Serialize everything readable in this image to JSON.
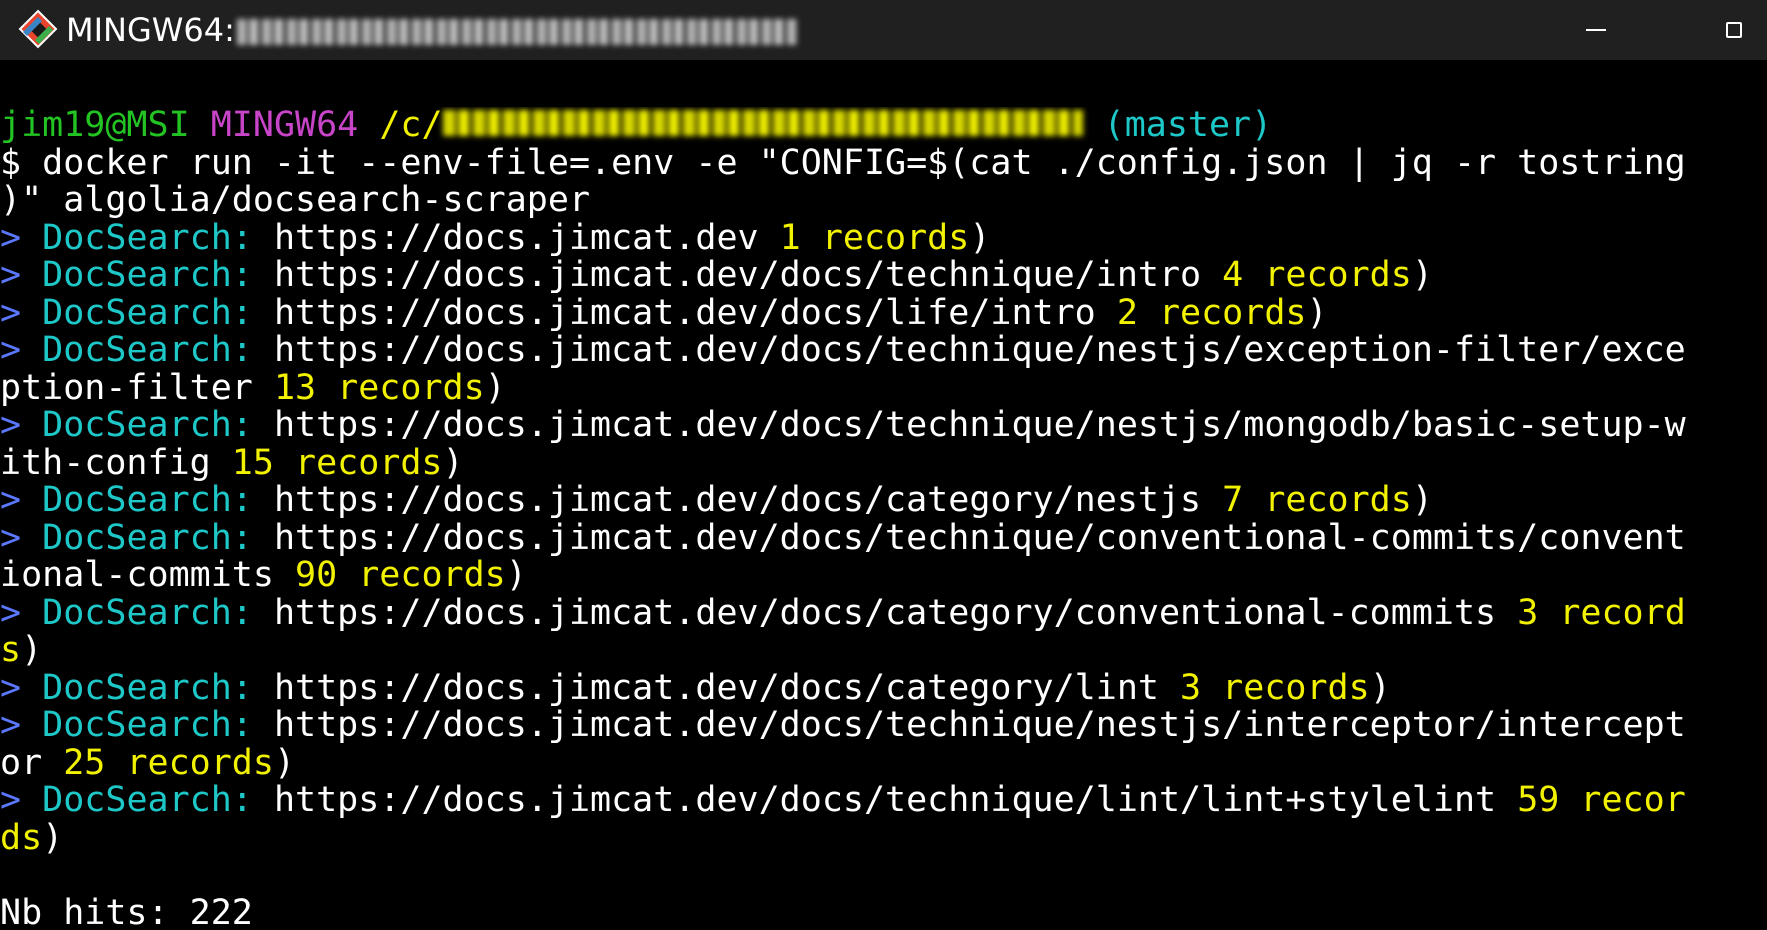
{
  "titlebar": {
    "title": "MINGW64:",
    "minimize_label": "—",
    "maximize_label": "□",
    "icon": "git-bash-icon"
  },
  "terminal": {
    "prompt_user": "jim19@MSI",
    "prompt_system": "MINGW64",
    "prompt_path_prefix": "/c/",
    "prompt_branch": "(master)",
    "command_line_1": "$ docker run -it --env-file=.env -e \"CONFIG=$(cat ./config.json | jq -r tostring",
    "command_line_2": ")\" algolia/docsearch-scraper",
    "marker": ">",
    "tool": "DocSearch:",
    "rows": [
      {
        "url": " https://docs.jimcat.dev",
        "records": " 1 records",
        "close": ")"
      },
      {
        "url": " https://docs.jimcat.dev/docs/technique/intro",
        "records": " 4 records",
        "close": ")"
      },
      {
        "url": " https://docs.jimcat.dev/docs/life/intro",
        "records": " 2 records",
        "close": ")"
      },
      {
        "url": " https://docs.jimcat.dev/docs/technique/nestjs/exception-filter/exce",
        "cont": "ption-filter",
        "records": " 13 records",
        "close": ")"
      },
      {
        "url": " https://docs.jimcat.dev/docs/technique/nestjs/mongodb/basic-setup-w",
        "cont": "ith-config",
        "records": " 15 records",
        "close": ")"
      },
      {
        "url": " https://docs.jimcat.dev/docs/category/nestjs",
        "records": " 7 records",
        "close": ")"
      },
      {
        "url": " https://docs.jimcat.dev/docs/technique/conventional-commits/convent",
        "cont": "ional-commits",
        "records": " 90 records",
        "close": ")"
      },
      {
        "url": " https://docs.jimcat.dev/docs/category/conventional-commits",
        "records": " 3 record",
        "records2": "s",
        "close": ")"
      },
      {
        "url": " https://docs.jimcat.dev/docs/category/lint",
        "records": " 3 records",
        "close": ")"
      },
      {
        "url": " https://docs.jimcat.dev/docs/technique/nestjs/interceptor/intercept",
        "cont": "or",
        "records": " 25 records",
        "close": ")"
      },
      {
        "url": " https://docs.jimcat.dev/docs/technique/lint/lint+stylelint",
        "records": " 59 recor",
        "records2": "ds",
        "close": ")"
      }
    ],
    "summary": "Nb hits: 222"
  },
  "colors": {
    "background": "#000000",
    "titlebar": "#202020",
    "prompt_user": "#22c322",
    "prompt_system": "#c844c8",
    "path": "#f2f200",
    "branch": "#1ec8c8",
    "marker": "#5b78ff",
    "docsearch": "#1ec8c8",
    "records": "#f2f200"
  }
}
